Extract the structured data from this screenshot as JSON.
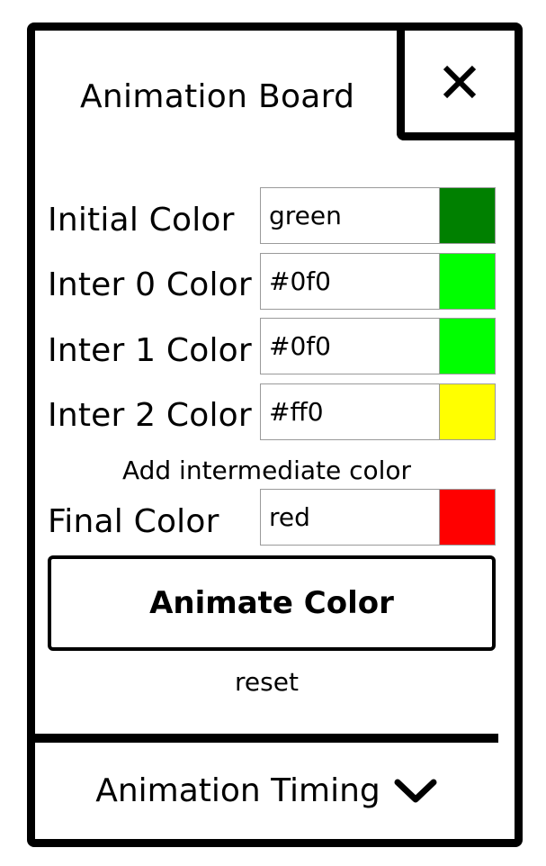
{
  "panel": {
    "title": "Animation Board",
    "close_icon": "close-icon"
  },
  "colors": {
    "initial": {
      "label": "Initial Color",
      "value": "green",
      "swatch": "#008000"
    },
    "inter0": {
      "label": "Inter 0 Color",
      "value": "#0f0",
      "swatch": "#00ff00"
    },
    "inter1": {
      "label": "Inter 1 Color",
      "value": "#0f0",
      "swatch": "#00ff00"
    },
    "inter2": {
      "label": "Inter 2 Color",
      "value": "#ff0",
      "swatch": "#ffff00"
    },
    "add_intermediate_label": "Add intermediate color",
    "final": {
      "label": "Final Color",
      "value": "red",
      "swatch": "#ff0000"
    }
  },
  "actions": {
    "animate_label": "Animate Color",
    "reset_label": "reset"
  },
  "timing_section": {
    "label": "Animation Timing",
    "icon": "chevron-down-icon"
  }
}
